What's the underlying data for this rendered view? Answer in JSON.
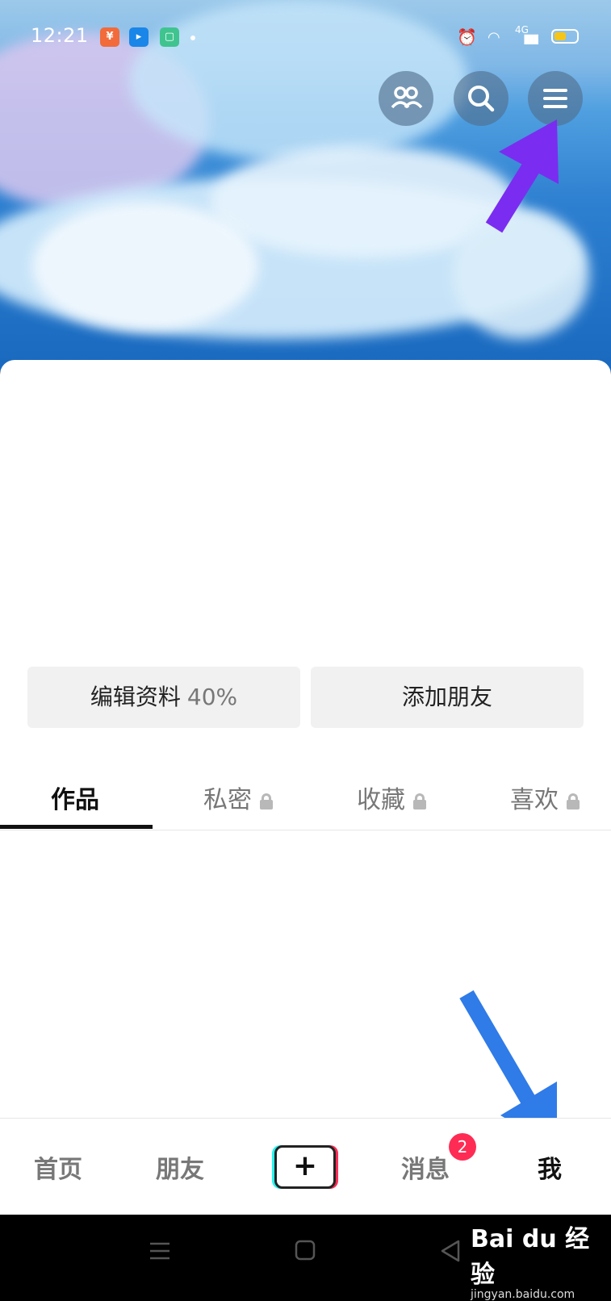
{
  "status_bar": {
    "time": "12:21",
    "network": "4G",
    "notification_icons": [
      "app-icon-orange",
      "app-icon-blue",
      "app-icon-green"
    ]
  },
  "header": {
    "icons": [
      "friends-icon",
      "search-icon",
      "menu-icon"
    ]
  },
  "profile": {
    "edit_label": "编辑资料",
    "edit_progress": "40%",
    "add_friend_label": "添加朋友"
  },
  "tabs": [
    {
      "label": "作品",
      "locked": false,
      "active": true
    },
    {
      "label": "私密",
      "locked": true,
      "active": false
    },
    {
      "label": "收藏",
      "locked": true,
      "active": false
    },
    {
      "label": "喜欢",
      "locked": true,
      "active": false
    }
  ],
  "bottom_nav": {
    "items": [
      "首页",
      "朋友",
      "消息",
      "我"
    ],
    "active": "我",
    "message_badge": "2"
  },
  "watermark": {
    "main": "Bai du 经验",
    "sub": "jingyan.baidu.com"
  },
  "colors": {
    "accent_red": "#fe2c55",
    "arrow_purple": "#7a2df0",
    "arrow_blue": "#2f7be8"
  }
}
